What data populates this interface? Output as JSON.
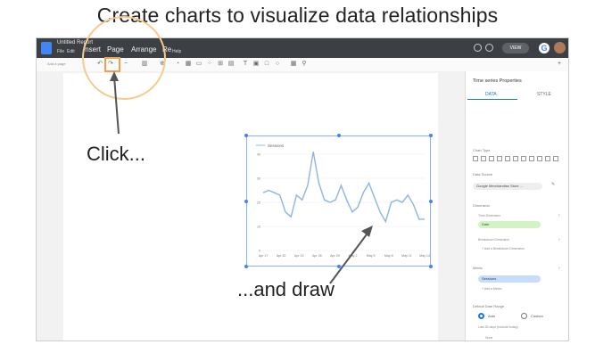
{
  "headline": "Create charts to visualize data relationships",
  "app": {
    "title": "Untitled Report",
    "menus_small": [
      "File",
      "Edit"
    ],
    "menus_big": [
      "Insert",
      "Page",
      "Arrange",
      "Re"
    ],
    "menu_help": "Help",
    "view_button": "VIEW",
    "add_page": "Add a page"
  },
  "chart": {
    "legend": "Sessions",
    "y_ticks": [
      "40",
      "30",
      "20",
      "10",
      "0"
    ],
    "x_ticks": [
      "Apr 17",
      "Apr 20",
      "Apr 23",
      "Apr 26",
      "Apr 29",
      "May 2",
      "May 5",
      "May 8",
      "May 11",
      "May 14"
    ],
    "line_color": "#8fb4e3"
  },
  "panel": {
    "title": "Time series Properties",
    "tabs": [
      "DATA",
      "STYLE"
    ],
    "chart_type_label": "Chart Type",
    "data_source_label": "Data Source",
    "data_source_value": "Google Merchandise Store ...",
    "dimension_label": "Dimension",
    "time_dimension_label": "Time Dimension",
    "time_dimension_value": "Date",
    "breakdown_label": "Breakdown Dimension",
    "add_breakdown": "+ Add a Breakdown Dimension",
    "metric_label": "Metric",
    "metric_value": "Sessions",
    "add_metric": "+ Add a Metric",
    "date_range_label": "Default Date Range",
    "auto_label": "Auto",
    "custom_label": "Custom",
    "date_range_note": "Last 28 days (exclude today)",
    "comparison_label": "None",
    "filter_label": "Filter"
  },
  "callouts": {
    "click": "Click...",
    "draw": "...and draw"
  },
  "colors": {
    "accent": "#1a73e8",
    "highlight_orange": "#f3a04a",
    "appbar": "#3c3f43"
  }
}
